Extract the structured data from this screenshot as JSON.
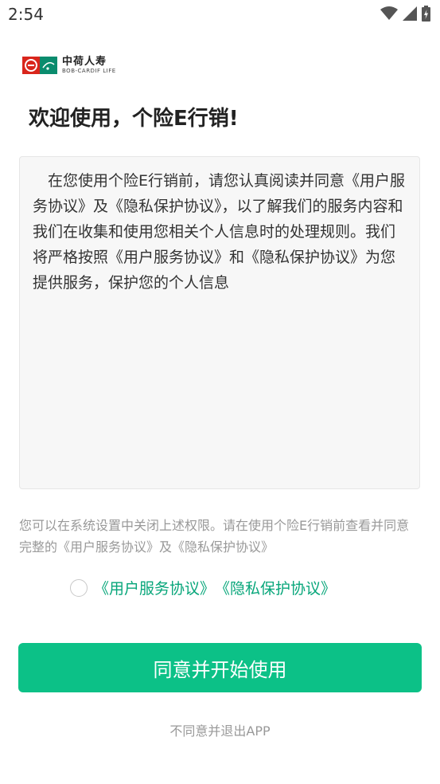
{
  "status_bar": {
    "time": "2:54",
    "icons": [
      "wifi-icon",
      "signal-icon",
      "battery-charging-icon"
    ]
  },
  "logo": {
    "cn": "中荷人寿",
    "en": "BOB-CARDIF LIFE"
  },
  "welcome_title": "欢迎使用，个险E行销!",
  "agreement": {
    "text": "在您使用个险E行销前，请您认真阅读并同意《用户服务协议》及《隐私保护协议》，以了解我们的服务内容和我们在收集和使用您相关个人信息时的处理规则。我们将严格按照《用户服务协议》和《隐私保护协议》为您提供服务，保护您的个人信息"
  },
  "notice": "您可以在系统设置中关闭上述权限。请在使用个险E行销前查看并同意完整的《用户服务协议》及《隐私保护协议》",
  "consent": {
    "user_agreement": "《用户服务协议》",
    "privacy_agreement": "《隐私保护协议》"
  },
  "agree_button": "同意并开始使用",
  "exit_link": "不同意并退出APP",
  "colors": {
    "accent": "#0cc187",
    "link": "#07a67a",
    "logo_red": "#d9261c",
    "logo_green": "#0a8c6e"
  }
}
